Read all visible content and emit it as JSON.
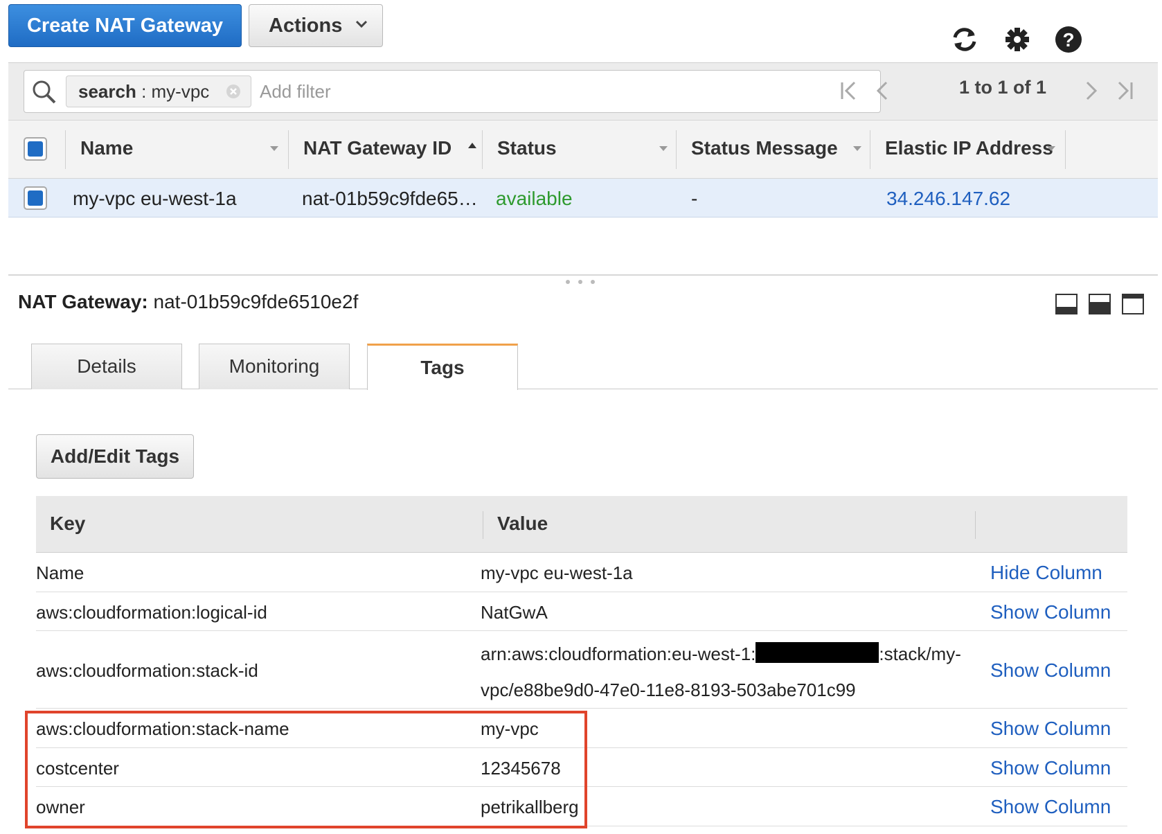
{
  "toolbar": {
    "create_label": "Create NAT Gateway",
    "actions_label": "Actions",
    "icons": [
      "refresh-icon",
      "gear-icon",
      "help-icon"
    ]
  },
  "filter": {
    "token_key": "search",
    "token_sep": " : ",
    "token_value": "my-vpc",
    "placeholder": "Add filter",
    "pagination": "1 to 1 of 1"
  },
  "grid": {
    "columns": [
      "Name",
      "NAT Gateway ID",
      "Status",
      "Status Message",
      "Elastic IP Address"
    ],
    "rows": [
      {
        "name": "my-vpc eu-west-1a",
        "id": "nat-01b59c9fde65…",
        "status": "available",
        "status_message": "-",
        "eip": "34.246.147.62"
      }
    ],
    "status_color": "#2e9a2e",
    "link_color": "#1f5fbf"
  },
  "details": {
    "title_label": "NAT Gateway:",
    "title_value": "nat-01b59c9fde6510e2f",
    "tabs": [
      "Details",
      "Monitoring",
      "Tags"
    ],
    "active_tab": "Tags",
    "add_tags_label": "Add/Edit Tags",
    "tags_columns": [
      "Key",
      "Value"
    ],
    "tags": [
      {
        "key": "Name",
        "value": "my-vpc eu-west-1a",
        "action": "Hide Column"
      },
      {
        "key": "aws:cloudformation:logical-id",
        "value": "NatGwA",
        "action": "Show Column"
      },
      {
        "key": "aws:cloudformation:stack-id",
        "value_line1_start": "arn:aws:cloudformation:eu-west-1:",
        "value_line1_end": ":stack/my-",
        "value_line2": "vpc/e88be9d0-47e0-11e8-8193-503abe701c99",
        "action": "Show Column"
      },
      {
        "key": "aws:cloudformation:stack-name",
        "value": "my-vpc",
        "action": "Show Column"
      },
      {
        "key": "costcenter",
        "value": "12345678",
        "action": "Show Column"
      },
      {
        "key": "owner",
        "value": "petrikallberg",
        "action": "Show Column"
      }
    ],
    "highlight_color": "#e0442c",
    "accent_tab_color": "#f0a14a"
  }
}
